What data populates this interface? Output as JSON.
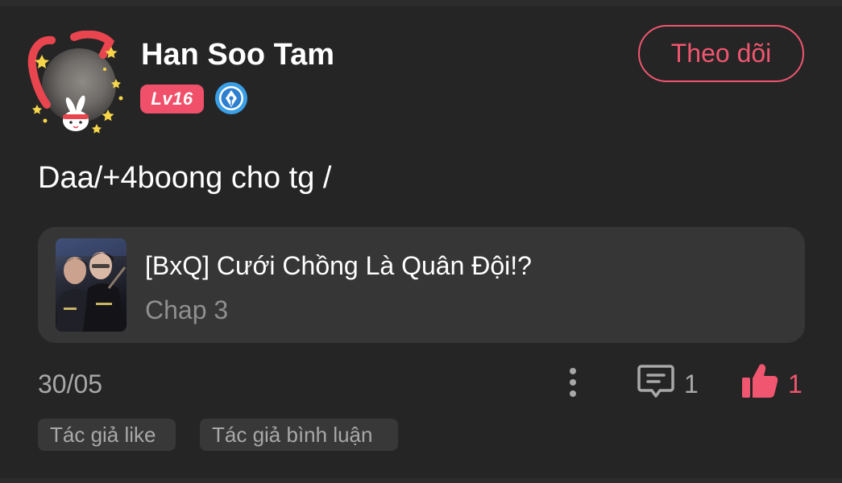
{
  "post": {
    "user": {
      "name": "Han Soo Tam",
      "level": "Lv16",
      "follow_label": "Theo dõi",
      "badge_icon": "pen-nib-badge-icon"
    },
    "comment": "Daa/+4boong cho tg /",
    "linked_story": {
      "title": "[BxQ] Cưới Chồng Là Quân Đội!?",
      "chapter": "Chap 3"
    },
    "date": "30/05",
    "comment_count": "1",
    "like_count": "1",
    "tags": [
      "Tác giả like",
      "Tác giả bình luận"
    ]
  },
  "colors": {
    "accent": "#f0566f",
    "background": "#252525",
    "card": "#363636",
    "muted_text": "#a8a8a8"
  }
}
